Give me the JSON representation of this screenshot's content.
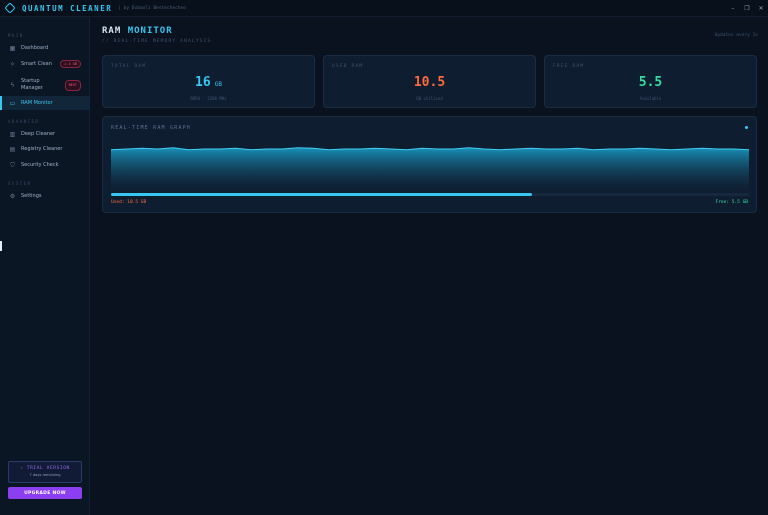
{
  "app": {
    "title": "QUANTUM CLEANER",
    "byline": "| by Dubaoli Bestechechno",
    "window_controls": [
      "–",
      "❐",
      "✕"
    ]
  },
  "sidebar": {
    "sections": [
      {
        "label": "MAIN"
      },
      {
        "label": "ADVANCED"
      },
      {
        "label": "SYSTEM"
      }
    ],
    "items": [
      {
        "label": "Dashboard",
        "icon": "grid-icon",
        "glyph": "▦"
      },
      {
        "label": "Smart Clean",
        "icon": "sparkle-icon",
        "glyph": "✧",
        "badge": "2.3 GB"
      },
      {
        "label": "Startup\nManager",
        "icon": "bolt-icon",
        "glyph": "ϟ",
        "badge": "BEST"
      },
      {
        "label": "RAM Monitor",
        "icon": "chip-icon",
        "glyph": "▭",
        "active": true
      },
      {
        "label": "Deep Cleaner",
        "icon": "trash-icon",
        "glyph": "▥"
      },
      {
        "label": "Registry Cleaner",
        "icon": "document-icon",
        "glyph": "▤"
      },
      {
        "label": "Security Check",
        "icon": "shield-icon",
        "glyph": "⛉"
      },
      {
        "label": "Settings",
        "icon": "gear-icon",
        "glyph": "⚙"
      }
    ],
    "trial": {
      "title": "✧ TRIAL VERSION",
      "subtitle": "7 days remaining"
    },
    "upgrade_label": "UPGRADE NOW"
  },
  "main": {
    "title_plain": "RAM",
    "title_accent": "MONITOR",
    "subtitle": "// REAL-TIME MEMORY ANALYSIS",
    "update_note": "Updates every 1s",
    "cards": [
      {
        "label": "TOTAL RAM",
        "value": "16",
        "unit": "GB",
        "note": "DDR4 · 3200 MHz",
        "color": "#38c7f0"
      },
      {
        "label": "USED RAM",
        "value": "10.5",
        "unit": "",
        "note": "GB utilized",
        "color": "#ff6a3d"
      },
      {
        "label": "FREE RAM",
        "value": "5.5",
        "unit": "",
        "note": "Available",
        "color": "#34e0a1"
      }
    ],
    "graph": {
      "title": "REAL-TIME RAM GRAPH",
      "used_label": "Used: 10.5 GB",
      "free_label": "Free: 5.5 GB",
      "usage_fraction": 0.66
    }
  },
  "chart_data": {
    "type": "area",
    "title": "REAL-TIME RAM GRAPH",
    "values": [
      10.4,
      10.5,
      10.6,
      10.5,
      10.7,
      10.4,
      10.5,
      10.5,
      10.6,
      10.4,
      10.5,
      10.5,
      10.7,
      10.6,
      10.4,
      10.5,
      10.5,
      10.6,
      10.5,
      10.4,
      10.6,
      10.5,
      10.5,
      10.7,
      10.5,
      10.4,
      10.5,
      10.6,
      10.5,
      10.5,
      10.6,
      10.4,
      10.5,
      10.5,
      10.6,
      10.5,
      10.4,
      10.5,
      10.6,
      10.5,
      10.5,
      10.4
    ],
    "ylim": [
      0,
      16
    ]
  },
  "colors": {
    "accent": "#38c7f0",
    "used": "#ff6a3d",
    "free": "#34e0a1",
    "upgrade": "#8b3ff0"
  }
}
